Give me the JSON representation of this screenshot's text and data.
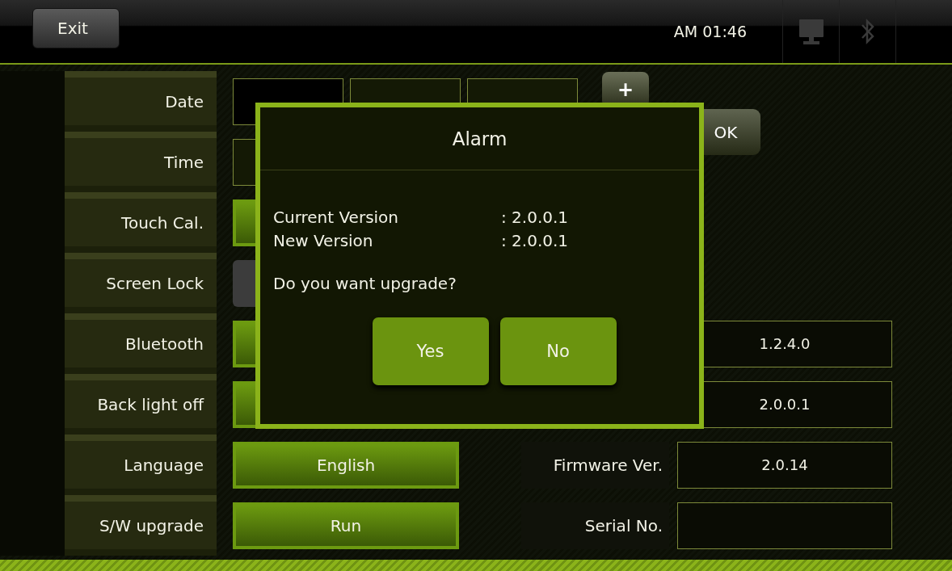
{
  "header": {
    "exit_button": "Exit",
    "clock": "AM 01:46"
  },
  "settings": [
    {
      "label": "Date",
      "kind": "date",
      "fields": [
        {
          "selected": true
        },
        {
          "selected": false
        },
        {
          "selected": false
        }
      ],
      "step_button": "+",
      "confirm_button": "OK"
    },
    {
      "label": "Time",
      "kind": "field"
    },
    {
      "label": "Touch Cal.",
      "kind": "button"
    },
    {
      "label": "Screen Lock",
      "kind": "toggle"
    },
    {
      "label": "Bluetooth",
      "kind": "button",
      "info": {
        "value": "1.2.4.0"
      }
    },
    {
      "label": "Back light off",
      "kind": "button",
      "info": {
        "value": "2.0.0.1"
      }
    },
    {
      "label": "Language",
      "kind": "button",
      "button": "English",
      "info": {
        "label": "Firmware Ver.",
        "value": "2.0.14"
      }
    },
    {
      "label": "S/W upgrade",
      "kind": "button",
      "button": "Run",
      "info": {
        "label": "Serial No."
      }
    }
  ],
  "dialog": {
    "title": "Alarm",
    "lines": [
      {
        "label": "Current Version",
        "value": ": 2.0.0.1"
      },
      {
        "label": "New Version",
        "value": ": 2.0.0.1"
      }
    ],
    "question": "Do you want upgrade?",
    "buttons": [
      "Yes",
      "No"
    ]
  }
}
